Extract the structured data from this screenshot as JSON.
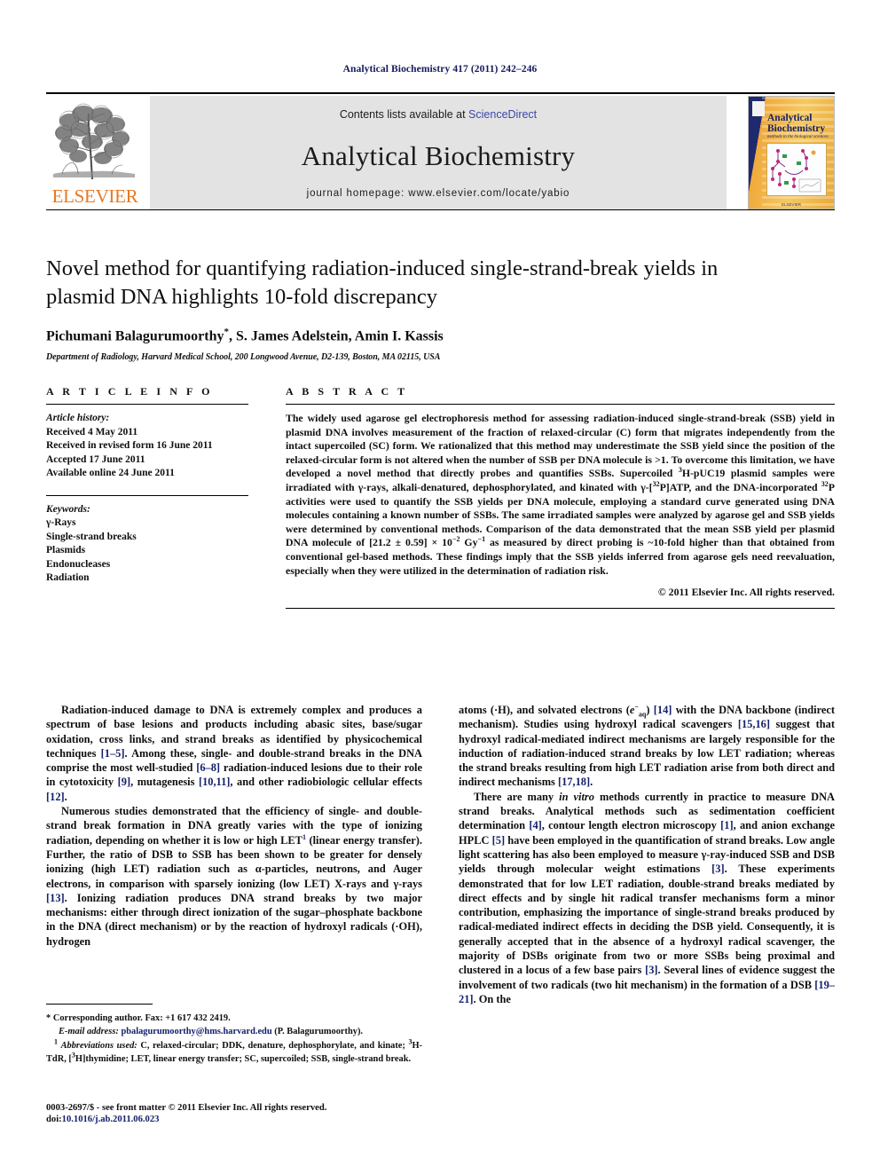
{
  "running_head": "Analytical Biochemistry 417 (2011) 242–246",
  "masthead": {
    "contents_prefix": "Contents lists available at ",
    "sciencedirect": "ScienceDirect",
    "journal_title": "Analytical Biochemistry",
    "homepage": "journal homepage: www.elsevier.com/locate/yabio",
    "publisher_wordmark": "ELSEVIER",
    "cover": {
      "title": "Analytical Biochemistry",
      "subtitle": "methods in the biological sciences",
      "publisher": "ELSEVIER"
    },
    "link_color": "#3b47a8",
    "elsevier_orange": "#e87722",
    "band_background": "#e3e3e3"
  },
  "article": {
    "title": "Novel method for quantifying radiation-induced single-strand-break yields in plasmid DNA highlights 10-fold discrepancy",
    "authors": "Pichumani Balagurumoorthy",
    "authors_rest": ", S. James Adelstein, Amin I. Kassis",
    "corresponding_mark": "*",
    "affiliation": "Department of Radiology, Harvard Medical School, 200 Longwood Avenue, D2-139, Boston, MA 02115, USA"
  },
  "info": {
    "section_label": "A R T I C L E   I N F O",
    "history_label": "Article history:",
    "history": [
      "Received 4 May 2011",
      "Received in revised form 16 June 2011",
      "Accepted 17 June 2011",
      "Available online 24 June 2011"
    ],
    "keywords_label": "Keywords:",
    "keywords": [
      "γ-Rays",
      "Single-strand breaks",
      "Plasmids",
      "Endonucleases",
      "Radiation"
    ]
  },
  "abstract": {
    "section_label": "A B S T R A C T",
    "part1": "The widely used agarose gel electrophoresis method for assessing radiation-induced single-strand-break (SSB) yield in plasmid DNA involves measurement of the fraction of relaxed-circular (C) form that migrates independently from the intact supercoiled (SC) form. We rationalized that this method may underestimate the SSB yield since the position of the relaxed-circular form is not altered when the number of SSB per DNA molecule is >1. To overcome this limitation, we have developed a novel method that directly probes and quantifies SSBs. Supercoiled ",
    "sup_3H": "3",
    "part2": "H-pUC19 plasmid samples were irradiated with γ-rays, alkali-denatured, dephosphorylated, and kinated with γ-[",
    "sup_32P_a": "32",
    "part3": "P]ATP, and the DNA-incorporated ",
    "sup_32P_b": "32",
    "part4": "P activities were used to quantify the SSB yields per DNA molecule, employing a standard curve generated using DNA molecules containing a known number of SSBs. The same irradiated samples were analyzed by agarose gel and SSB yields were determined by conventional methods. Comparison of the data demonstrated that the mean SSB yield per plasmid DNA molecule of [21.2 ± 0.59] × 10",
    "sup_minus2": "−2",
    "part5": " Gy",
    "sup_minus1": "−1",
    "part6": " as measured by direct probing is ~10-fold higher than that obtained from conventional gel-based methods. These findings imply that the SSB yields inferred from agarose gels need reevaluation, especially when they were utilized in the determination of radiation risk.",
    "copyright": "© 2011 Elsevier Inc. All rights reserved."
  },
  "body": {
    "left": {
      "p1_a": "Radiation-induced damage to DNA is extremely complex and produces a spectrum of base lesions and products including abasic sites, base/sugar oxidation, cross links, and strand breaks as identified by physicochemical techniques ",
      "p1_r1": "[1–5]",
      "p1_b": ". Among these, single- and double-strand breaks in the DNA comprise the most well-studied ",
      "p1_r2": "[6–8]",
      "p1_c": " radiation-induced lesions due to their role in cytotoxicity ",
      "p1_r3": "[9]",
      "p1_d": ", mutagenesis ",
      "p1_r4": "[10,11]",
      "p1_e": ", and other radiobiologic cellular effects ",
      "p1_r5": "[12]",
      "p1_f": ".",
      "p2_a": "Numerous studies demonstrated that the efficiency of single- and double-strand break formation in DNA greatly varies with the type of ionizing radiation, depending on whether it is low or high LET",
      "p2_fn": "1",
      "p2_b": " (linear energy transfer). Further, the ratio of DSB to SSB has been shown to be greater for densely ionizing (high LET) radiation such as α-particles, neutrons, and Auger electrons, in comparison with sparsely ionizing (low LET) X-rays and γ-rays ",
      "p2_r1": "[13]",
      "p2_c": ". Ionizing radiation produces DNA strand breaks by two major mechanisms: either through direct ionization of the sugar–phosphate backbone in the DNA (direct mechanism) or by the reaction of hydroxyl radicals (·OH), hydrogen"
    },
    "right": {
      "p3_a": "atoms (·H), and solvated electrons (",
      "p3_e": "e",
      "p3_esub": "aq",
      "p3_b": ") ",
      "p3_r1": "[14]",
      "p3_c": " with the DNA backbone (indirect mechanism). Studies using hydroxyl radical scavengers ",
      "p3_r2": "[15,16]",
      "p3_d": " suggest that hydroxyl radical-mediated indirect mechanisms are largely responsible for the induction of radiation-induced strand breaks by low LET radiation; whereas the strand breaks resulting from high LET radiation arise from both direct and indirect mechanisms ",
      "p3_r3": "[17,18]",
      "p3_f": ".",
      "p4_a": "There are many ",
      "p4_it": "in vitro",
      "p4_b": " methods currently in practice to measure DNA strand breaks. Analytical methods such as sedimentation coefficient determination ",
      "p4_r1": "[4]",
      "p4_c": ", contour length electron microscopy ",
      "p4_r2": "[1]",
      "p4_d": ", and anion exchange HPLC ",
      "p4_r3": "[5]",
      "p4_e": " have been employed in the quantification of strand breaks. Low angle light scattering has also been employed to measure γ-ray-induced SSB and DSB yields through molecular weight estimations ",
      "p4_r4": "[3]",
      "p4_f": ". These experiments demonstrated that for low LET radiation, double-strand breaks mediated by direct effects and by single hit radical transfer mechanisms form a minor contribution, emphasizing the importance of single-strand breaks produced by radical-mediated indirect effects in deciding the DSB yield. Consequently, it is generally accepted that in the absence of a hydroxyl radical scavenger, the majority of DSBs originate from two or more SSBs being proximal and clustered in a locus of a few base pairs ",
      "p4_r5": "[3]",
      "p4_g": ". Several lines of evidence suggest the involvement of two radicals (two hit mechanism) in the formation of a DSB ",
      "p4_r6": "[19–21]",
      "p4_h": ". On the"
    }
  },
  "footnotes": {
    "corresponding": "Corresponding author. Fax: +1 617 432 2419.",
    "corresponding_mark": "*",
    "email_label": "E-mail address:",
    "email": "pbalagurumoorthy@hms.harvard.edu",
    "email_suffix": "(P. Balagurumoorthy).",
    "abbr_mark": "1",
    "abbr_label": "Abbreviations used:",
    "abbr_a": " C, relaxed-circular; DDK, denature, dephosphorylate, and kinate; ",
    "abbr_sup1": "3",
    "abbr_b": "H-TdR, [",
    "abbr_sup2": "3",
    "abbr_c": "H]thymidine; LET, linear energy transfer; SC, supercoiled; SSB, single-strand break."
  },
  "imprint": {
    "issn_line": "0003-2697/$ - see front matter © 2011 Elsevier Inc. All rights reserved.",
    "doi_label": "doi:",
    "doi": "10.1016/j.ab.2011.06.023"
  }
}
